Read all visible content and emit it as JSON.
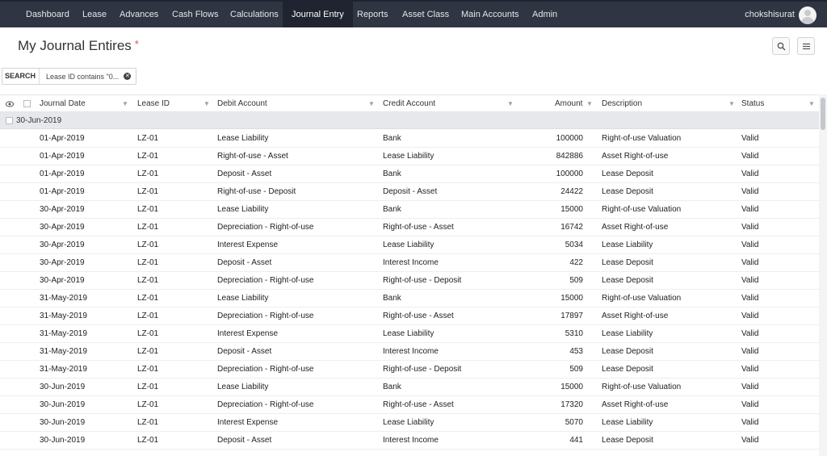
{
  "nav": {
    "items": [
      "Dashboard",
      "Lease",
      "Advances",
      "Cash Flows",
      "Calculations",
      "Journal Entry",
      "Reports",
      "Asset Class",
      "Main Accounts",
      "Admin"
    ],
    "active": "Journal Entry",
    "user": "chokshisurat"
  },
  "page": {
    "title": "My Journal Entires",
    "required_mark": "*"
  },
  "search": {
    "label": "SEARCH",
    "chip": "Lease ID contains \"0..."
  },
  "table": {
    "columns": [
      "Journal Date",
      "Lease ID",
      "Debit Account",
      "Credit Account",
      "Amount",
      "Description",
      "Status"
    ],
    "group_label": "30-Jun-2019",
    "rows": [
      [
        "01-Apr-2019",
        "LZ-01",
        "Lease Liability",
        "Bank",
        "100000",
        "Right-of-use Valuation",
        "Valid"
      ],
      [
        "01-Apr-2019",
        "LZ-01",
        "Right-of-use - Asset",
        "Lease Liability",
        "842886",
        "Asset Right-of-use",
        "Valid"
      ],
      [
        "01-Apr-2019",
        "LZ-01",
        "Deposit - Asset",
        "Bank",
        "100000",
        "Lease Deposit",
        "Valid"
      ],
      [
        "01-Apr-2019",
        "LZ-01",
        "Right-of-use - Deposit",
        "Deposit - Asset",
        "24422",
        "Lease Deposit",
        "Valid"
      ],
      [
        "30-Apr-2019",
        "LZ-01",
        "Lease Liability",
        "Bank",
        "15000",
        "Right-of-use Valuation",
        "Valid"
      ],
      [
        "30-Apr-2019",
        "LZ-01",
        "Depreciation - Right-of-use",
        "Right-of-use - Asset",
        "16742",
        "Asset Right-of-use",
        "Valid"
      ],
      [
        "30-Apr-2019",
        "LZ-01",
        "Interest Expense",
        "Lease Liability",
        "5034",
        "Lease Liability",
        "Valid"
      ],
      [
        "30-Apr-2019",
        "LZ-01",
        "Deposit - Asset",
        "Interest Income",
        "422",
        "Lease Deposit",
        "Valid"
      ],
      [
        "30-Apr-2019",
        "LZ-01",
        "Depreciation - Right-of-use",
        "Right-of-use - Deposit",
        "509",
        "Lease Deposit",
        "Valid"
      ],
      [
        "31-May-2019",
        "LZ-01",
        "Lease Liability",
        "Bank",
        "15000",
        "Right-of-use Valuation",
        "Valid"
      ],
      [
        "31-May-2019",
        "LZ-01",
        "Depreciation - Right-of-use",
        "Right-of-use - Asset",
        "17897",
        "Asset Right-of-use",
        "Valid"
      ],
      [
        "31-May-2019",
        "LZ-01",
        "Interest Expense",
        "Lease Liability",
        "5310",
        "Lease Liability",
        "Valid"
      ],
      [
        "31-May-2019",
        "LZ-01",
        "Deposit - Asset",
        "Interest Income",
        "453",
        "Lease Deposit",
        "Valid"
      ],
      [
        "31-May-2019",
        "LZ-01",
        "Depreciation - Right-of-use",
        "Right-of-use - Deposit",
        "509",
        "Lease Deposit",
        "Valid"
      ],
      [
        "30-Jun-2019",
        "LZ-01",
        "Lease Liability",
        "Bank",
        "15000",
        "Right-of-use Valuation",
        "Valid"
      ],
      [
        "30-Jun-2019",
        "LZ-01",
        "Depreciation - Right-of-use",
        "Right-of-use - Asset",
        "17320",
        "Asset Right-of-use",
        "Valid"
      ],
      [
        "30-Jun-2019",
        "LZ-01",
        "Interest Expense",
        "Lease Liability",
        "5070",
        "Lease Liability",
        "Valid"
      ],
      [
        "30-Jun-2019",
        "LZ-01",
        "Deposit - Asset",
        "Interest Income",
        "441",
        "Lease Deposit",
        "Valid"
      ]
    ]
  },
  "colors": {
    "nav_bg": "#2f3542",
    "nav_active": "#1f2430",
    "group_bg": "#e6e8ec"
  }
}
